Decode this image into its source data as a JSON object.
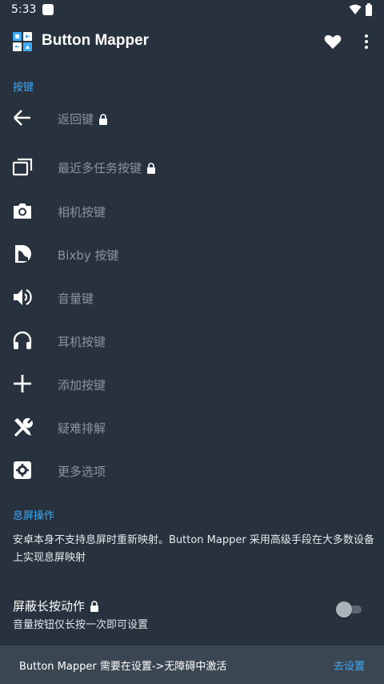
{
  "status_bar": {
    "time": "5:33"
  },
  "app_bar": {
    "title": "Button Mapper"
  },
  "sections": {
    "keys_header": "按键",
    "screen_off_header": "息屏操作"
  },
  "menu_items": [
    {
      "label": "返回键",
      "locked": true,
      "icon": "back-arrow-icon"
    },
    {
      "label": "最近多任务按键",
      "locked": true,
      "icon": "recent-apps-icon"
    },
    {
      "label": "相机按键",
      "locked": false,
      "icon": "camera-icon"
    },
    {
      "label": "Bixby 按键",
      "locked": false,
      "icon": "bixby-icon"
    },
    {
      "label": "音量键",
      "locked": false,
      "icon": "volume-icon"
    },
    {
      "label": "耳机按键",
      "locked": false,
      "icon": "headphones-icon"
    },
    {
      "label": "添加按键",
      "locked": false,
      "icon": "plus-icon"
    },
    {
      "label": "疑难排解",
      "locked": false,
      "icon": "tools-icon"
    },
    {
      "label": "更多选项",
      "locked": false,
      "icon": "settings-icon"
    }
  ],
  "screen_off": {
    "description": "安卓本身不支持息屏时重新映射。Button Mapper 采用高级手段在大多数设备上实现息屏映射",
    "block_title": "屏蔽长按动作",
    "block_subtitle": "音量按钮仅长按一次即可设置",
    "toggle_on": false
  },
  "snackbar": {
    "message": "Button Mapper 需要在设置->无障碍中激活",
    "action": "去设置"
  },
  "colors": {
    "background": "#27323e",
    "accent": "#3fa9f5",
    "muted_text": "#8a949e",
    "snackbar": "#3a4652"
  }
}
